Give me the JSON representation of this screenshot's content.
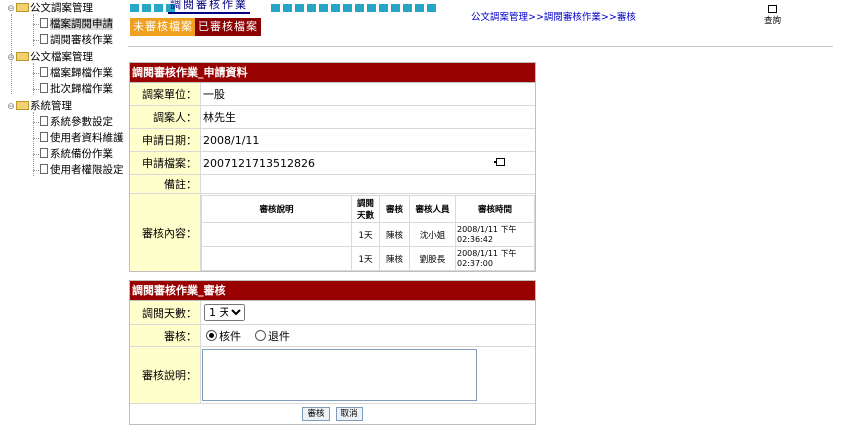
{
  "tree": {
    "g1": "公文調案管理",
    "g1_items": [
      "檔案調閱申請",
      "調閱審核作業"
    ],
    "g2": "公文檔案管理",
    "g2_items": [
      "檔案歸檔作業",
      "批次歸檔作業"
    ],
    "g3": "系統管理",
    "g3_items": [
      "系統參數設定",
      "使用者資料維護",
      "系統備份作業",
      "使用者權限設定"
    ]
  },
  "header": {
    "title": "調閱審核作業",
    "tab_pending": "未審核檔案",
    "tab_done": "已審核檔案",
    "breadcrumb": "公文調案管理>>調閱審核作業>>審核",
    "query": "查詢"
  },
  "apply": {
    "title": "調閱審核作業_申請資料",
    "unit_label": "調案單位：",
    "unit": "一股",
    "person_label": "調案人：",
    "person": "林先生",
    "date_label": "申請日期：",
    "date": "2008/1/11",
    "file_label": "申請檔案：",
    "file": "2007121713512826",
    "note_label": "備註：",
    "note": "",
    "review_label": "審核內容：",
    "review_headers": [
      "審核說明",
      "調閱天數",
      "審核",
      "審核人員",
      "審核時間"
    ],
    "review_rows": [
      {
        "desc": "",
        "days": "1天",
        "result": "陳核",
        "reviewer": "沈小姐",
        "time": "2008/1/11 下午 02:36:42"
      },
      {
        "desc": "",
        "days": "1天",
        "result": "陳核",
        "reviewer": "劉股長",
        "time": "2008/1/11 下午 02:37:00"
      }
    ]
  },
  "audit": {
    "title": "調閱審核作業_審核",
    "days_label": "調閱天數：",
    "days_value": "1 天",
    "decision_label": "審核：",
    "opt_approve": "核件",
    "opt_return": "退件",
    "memo_label": "審核說明：",
    "memo_value": "",
    "submit_label": "審核",
    "cancel_label": "取消"
  },
  "colors": {
    "header_bar": "#990000",
    "label_bg": "#ffffcc",
    "tab_pending": "#f0a020",
    "tab_done": "#8b0000",
    "link": "#0000cc"
  }
}
